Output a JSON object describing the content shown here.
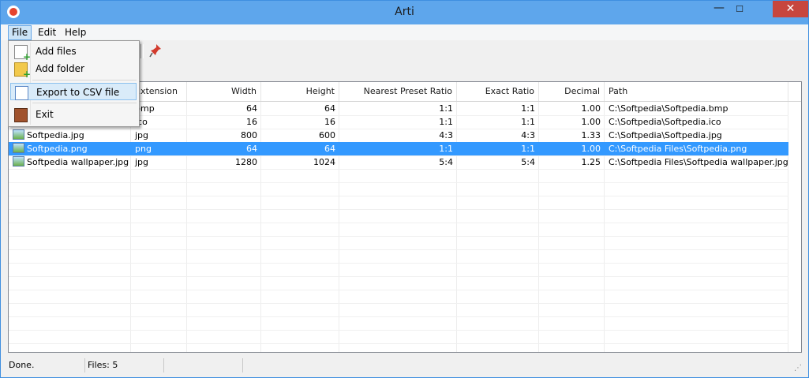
{
  "window": {
    "title": "Arti",
    "close_glyph": "✕",
    "minimize_glyph": "—",
    "maximize_glyph": "☐"
  },
  "menu": {
    "file": "File",
    "edit": "Edit",
    "help": "Help"
  },
  "file_menu": {
    "add_files": "Add files",
    "add_folder": "Add folder",
    "export_csv": "Export to CSV file",
    "exit": "Exit"
  },
  "table": {
    "columns": [
      "",
      "Extension",
      "Width",
      "Height",
      "Nearest Preset Ratio",
      "Exact Ratio",
      "Decimal",
      "Path"
    ],
    "rows": [
      {
        "name": "",
        "ext": "bmp",
        "width": "64",
        "height": "64",
        "nearest": "1:1",
        "exact": "1:1",
        "decimal": "1.00",
        "path": "C:\\Softpedia\\Softpedia.bmp"
      },
      {
        "name": "",
        "ext": "ico",
        "width": "16",
        "height": "16",
        "nearest": "1:1",
        "exact": "1:1",
        "decimal": "1.00",
        "path": "C:\\Softpedia\\Softpedia.ico"
      },
      {
        "name": "Softpedia.jpg",
        "ext": "jpg",
        "width": "800",
        "height": "600",
        "nearest": "4:3",
        "exact": "4:3",
        "decimal": "1.33",
        "path": "C:\\Softpedia\\Softpedia.jpg"
      },
      {
        "name": "Softpedia.png",
        "ext": "png",
        "width": "64",
        "height": "64",
        "nearest": "1:1",
        "exact": "1:1",
        "decimal": "1.00",
        "path": "C:\\Softpedia Files\\Softpedia.png"
      },
      {
        "name": "Softpedia wallpaper.jpg",
        "ext": "jpg",
        "width": "1280",
        "height": "1024",
        "nearest": "5:4",
        "exact": "5:4",
        "decimal": "1.25",
        "path": "C:\\Softpedia Files\\Softpedia wallpaper.jpg"
      }
    ],
    "selected_row": 3
  },
  "status": {
    "state": "Done.",
    "files": "Files: 5"
  },
  "colors": {
    "titlebar": "#5ea6ec",
    "selection": "#3399ff",
    "close": "#c7463e"
  },
  "icons": [
    "app-icon",
    "pin-icon",
    "add-files-icon",
    "add-folder-icon",
    "csv-icon",
    "exit-icon",
    "image-file-icon"
  ]
}
